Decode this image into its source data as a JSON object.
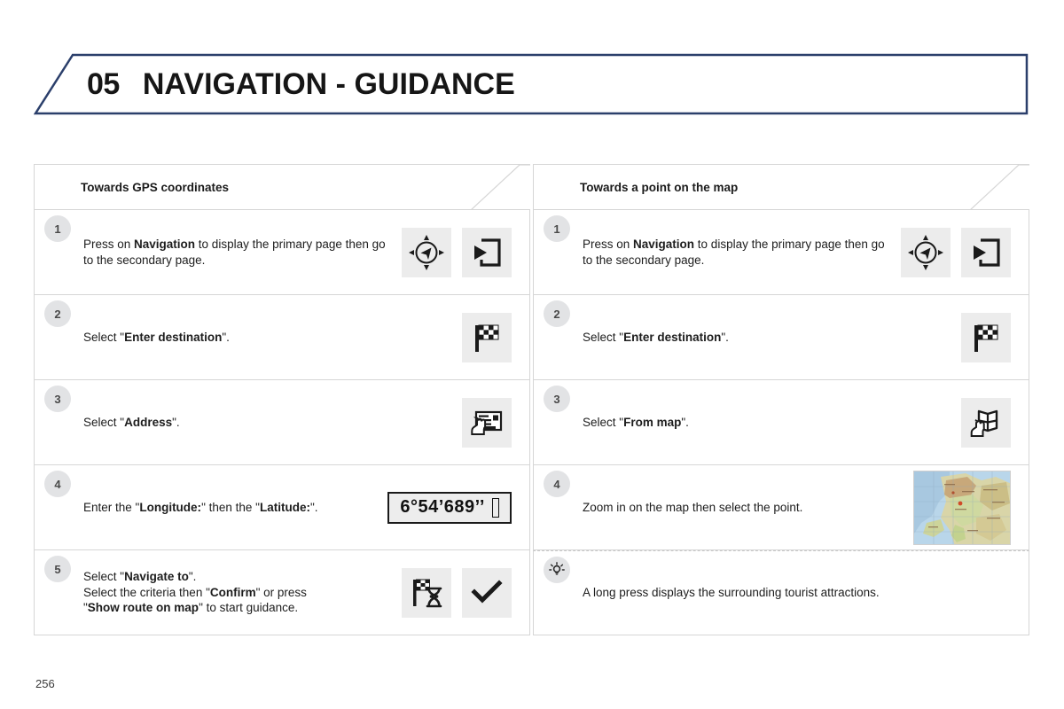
{
  "header": {
    "chapter_number": "05",
    "chapter_title": "NAVIGATION - GUIDANCE",
    "border_color": "#2b3f6b"
  },
  "page": {
    "number": "256"
  },
  "columns": [
    {
      "id": "gps-coordinates",
      "title": "Towards GPS coordinates",
      "steps": [
        {
          "badge": "1",
          "text_html": "Press on <b>Navigation</b> to display the primary page then go to the secondary page.",
          "icons": [
            "navigation-compass-icon",
            "secondary-page-icon"
          ]
        },
        {
          "badge": "2",
          "text_html": "Select \"<b>Enter destination</b>\".",
          "icons": [
            "checkered-flag-icon"
          ]
        },
        {
          "badge": "3",
          "text_html": "Select \"<b>Address</b>\".",
          "icons": [
            "address-hand-icon"
          ]
        },
        {
          "badge": "4",
          "text_html": "Enter the \"<b>Longitude:</b>\" then the \"<b>Latitude:</b>\".",
          "icons": [
            "coordinate-field"
          ],
          "coordinate_value": "6°54’689’’"
        },
        {
          "badge": "5",
          "text_html": "Select \"<b>Navigate to</b>\".<br>Select the criteria then \"<b>Confirm</b>\" or press<br>\"<b>Show route on map</b>\" to start guidance.",
          "icons": [
            "flag-hourglass-icon",
            "checkmark-icon"
          ]
        }
      ]
    },
    {
      "id": "point-on-map",
      "title": "Towards a point on the map",
      "steps": [
        {
          "badge": "1",
          "text_html": "Press on <b>Navigation</b> to display the primary page then go to the secondary page.",
          "icons": [
            "navigation-compass-icon",
            "secondary-page-icon"
          ]
        },
        {
          "badge": "2",
          "text_html": "Select \"<b>Enter destination</b>\".",
          "icons": [
            "checkered-flag-icon"
          ]
        },
        {
          "badge": "3",
          "text_html": "Select \"<b>From map</b>\".",
          "icons": [
            "folded-map-hand-icon"
          ]
        },
        {
          "badge": "4",
          "text_html": "Zoom in on the map then select the point.",
          "icons": [
            "map-thumbnail"
          ]
        },
        {
          "badge": "☀",
          "badge_type": "tip",
          "text_html": "A long press displays the surrounding tourist attractions.",
          "icons": [],
          "separator": "dashed"
        }
      ]
    }
  ]
}
